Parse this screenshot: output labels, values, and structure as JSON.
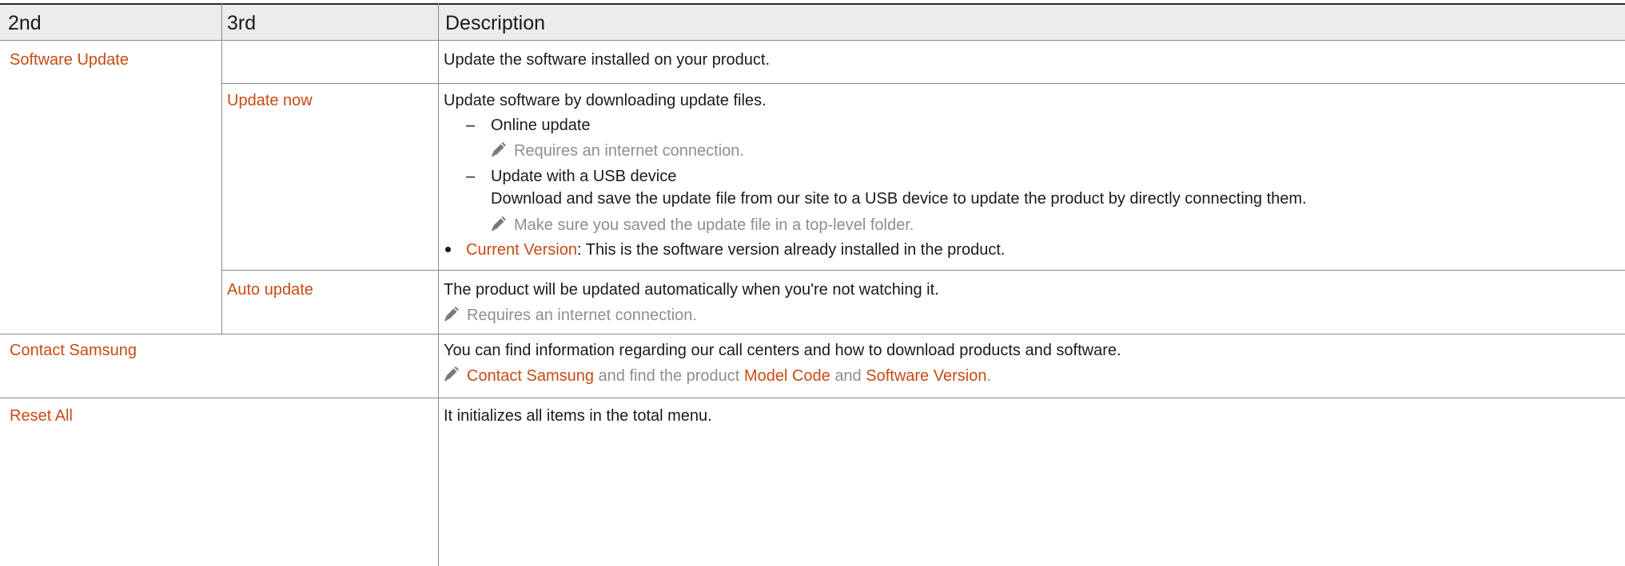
{
  "table": {
    "headers": {
      "col2": "2nd",
      "col3": "3rd",
      "desc": "Description"
    },
    "rows": {
      "software_update": {
        "label": "Software Update",
        "desc": "Update the software installed on your product."
      },
      "update_now": {
        "label": "Update now",
        "desc": "Update software by downloading update files.",
        "dash": "–",
        "online": "Online update",
        "online_note": "Requires an internet connection.",
        "usb": "Update with a USB device",
        "usb_detail": "Download and save the update file from our site to a USB device to update the product by directly connecting them.",
        "usb_note": "Make sure you saved the update file in a top-level folder.",
        "current_version_link": "Current Version",
        "current_version_text": ": This is the software version already installed in the product."
      },
      "auto_update": {
        "label": "Auto update",
        "desc": "The product will be updated automatically when you're not watching it.",
        "note": "Requires an internet connection."
      },
      "contact_samsung": {
        "label": "Contact Samsung",
        "desc": "You can find information regarding our call centers and how to download products and software.",
        "note_link1": "Contact Samsung",
        "note_mid1": "and find the product",
        "note_link2": "Model Code",
        "note_mid2": "and",
        "note_link3": "Software Version",
        "note_end": "."
      },
      "reset_all": {
        "label": "Reset All",
        "desc": "It initializes all items in the total menu."
      }
    }
  },
  "colors": {
    "accent": "#c84b14",
    "note": "#8e8e8e",
    "header_bg": "#ececec"
  },
  "icons": {
    "note_icon": "pencil-icon"
  }
}
